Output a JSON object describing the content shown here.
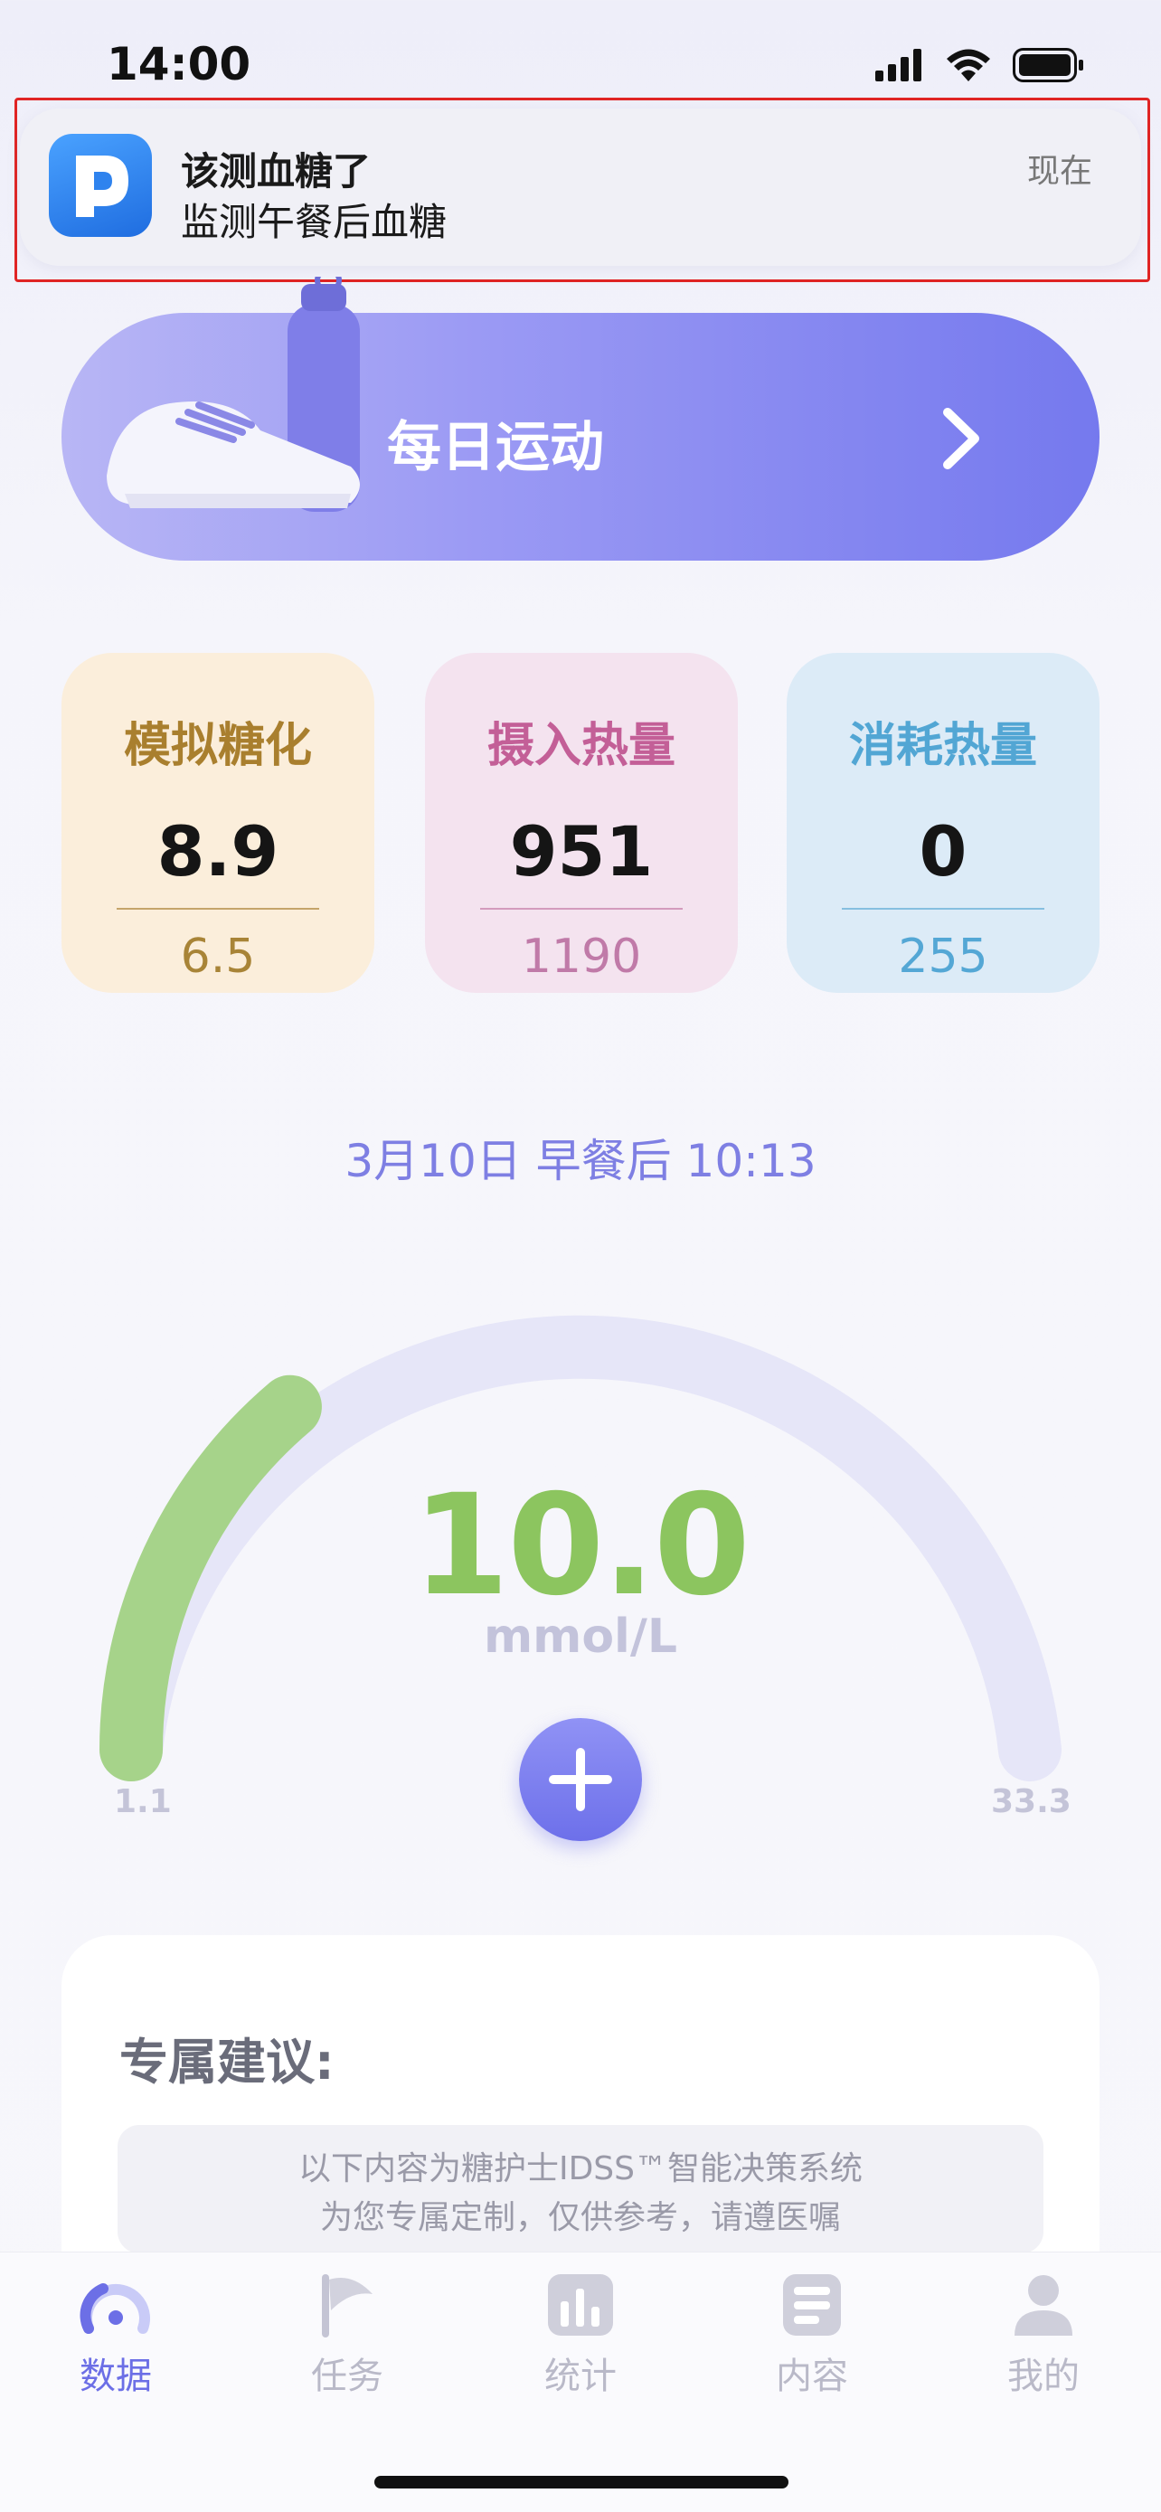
{
  "status_bar": {
    "time": "14:00"
  },
  "notification": {
    "title": "该测血糖了",
    "body": "监测午餐后血糖",
    "time": "现在"
  },
  "exercise_banner": {
    "label": "每日运动"
  },
  "stats": {
    "hba1c": {
      "title": "模拟糖化",
      "value": "8.9",
      "sub": "6.5"
    },
    "intake": {
      "title": "摄入热量",
      "value": "951",
      "sub": "1190"
    },
    "burn": {
      "title": "消耗热量",
      "value": "0",
      "sub": "255"
    }
  },
  "reading": {
    "time_label": "3月10日  早餐后  10:13",
    "value": "10.0",
    "unit": "mmol/L",
    "min": "1.1",
    "max": "33.3",
    "gauge_level_value": 10.0
  },
  "advice": {
    "title": "专属建议:",
    "note_line1": "以下内容为糖护士IDSS™智能决策系统",
    "note_line2": "为您专属定制，仅供参考，请遵医嘱"
  },
  "tabbar": {
    "items": [
      {
        "label": "数据",
        "icon": "gauge-icon",
        "active": true
      },
      {
        "label": "任务",
        "icon": "flag-icon",
        "active": false
      },
      {
        "label": "统计",
        "icon": "bar-chart-icon",
        "active": false
      },
      {
        "label": "内容",
        "icon": "list-icon",
        "active": false
      },
      {
        "label": "我的",
        "icon": "person-icon",
        "active": false
      }
    ]
  },
  "colors": {
    "accent": "#6c6fe6",
    "gauge_fill": "#a6d38a",
    "gauge_track": "#e6e6f8",
    "value_green": "#8cc55f"
  }
}
